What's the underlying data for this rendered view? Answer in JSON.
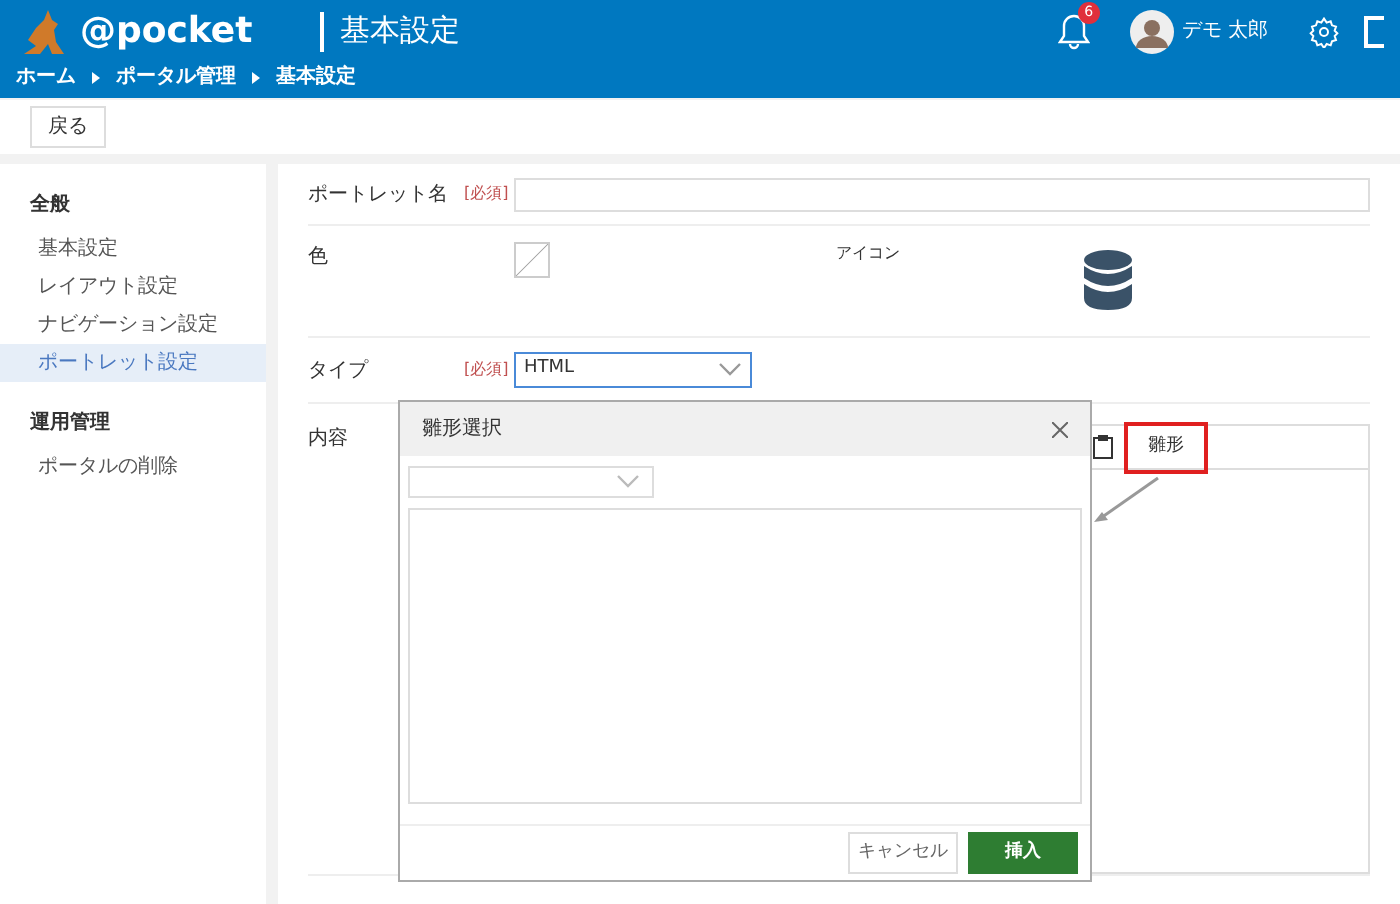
{
  "header": {
    "logo_text": "@pocket",
    "title": "基本設定",
    "notifications": "6",
    "user_name": "デモ 太郎"
  },
  "breadcrumb": [
    "ホーム",
    "ポータル管理",
    "基本設定"
  ],
  "toolbar": {
    "back_button": "戻る"
  },
  "sidebar": {
    "sections": [
      {
        "title": "全般",
        "items": [
          {
            "label": "基本設定",
            "selected": false
          },
          {
            "label": "レイアウト設定",
            "selected": false
          },
          {
            "label": "ナビゲーション設定",
            "selected": false
          },
          {
            "label": "ポートレット設定",
            "selected": true
          }
        ]
      },
      {
        "title": "運用管理",
        "items": [
          {
            "label": "ポータルの削除",
            "selected": false
          }
        ]
      }
    ]
  },
  "form": {
    "name_label": "ポートレット名",
    "name_required": "[必須]",
    "color_label": "色",
    "icon_label": "アイコン",
    "type_label": "タイプ",
    "type_required": "[必須]",
    "type_value": "HTML",
    "content_label": "内容",
    "template_button": "雛形"
  },
  "dialog": {
    "title": "雛形選択",
    "cancel": "キャンセル",
    "insert": "挿入"
  }
}
